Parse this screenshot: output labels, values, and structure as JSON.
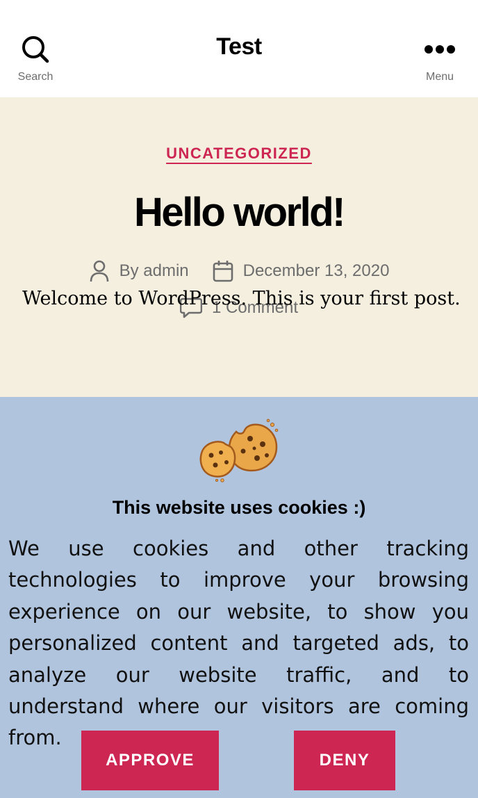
{
  "header": {
    "search_label": "Search",
    "site_title": "Test",
    "menu_label": "Menu"
  },
  "post": {
    "category": "UNCATEGORIZED",
    "title": "Hello world!",
    "author": "By admin",
    "date": "December 13, 2020",
    "comments": "1 Comment",
    "excerpt_peek": "Welcome to WordPress. This is your first post."
  },
  "cookie_banner": {
    "title": "This website uses cookies :)",
    "text": "We use cookies and other tracking technologies to improve your browsing experience on our website, to show you personalized content and targeted ads, to analyze our website traffic, and to understand where our visitors are coming from.",
    "approve_label": "APPROVE",
    "deny_label": "DENY",
    "background_color": "#b0c4de",
    "button_color": "#cd2653"
  },
  "colors": {
    "accent": "#cd2653",
    "hero_background": "#f5efe0",
    "meta_text": "#6d6d6d"
  },
  "icons": [
    "search-icon",
    "ellipsis-icon",
    "user-icon",
    "calendar-icon",
    "comment-icon",
    "cookies-icon"
  ]
}
